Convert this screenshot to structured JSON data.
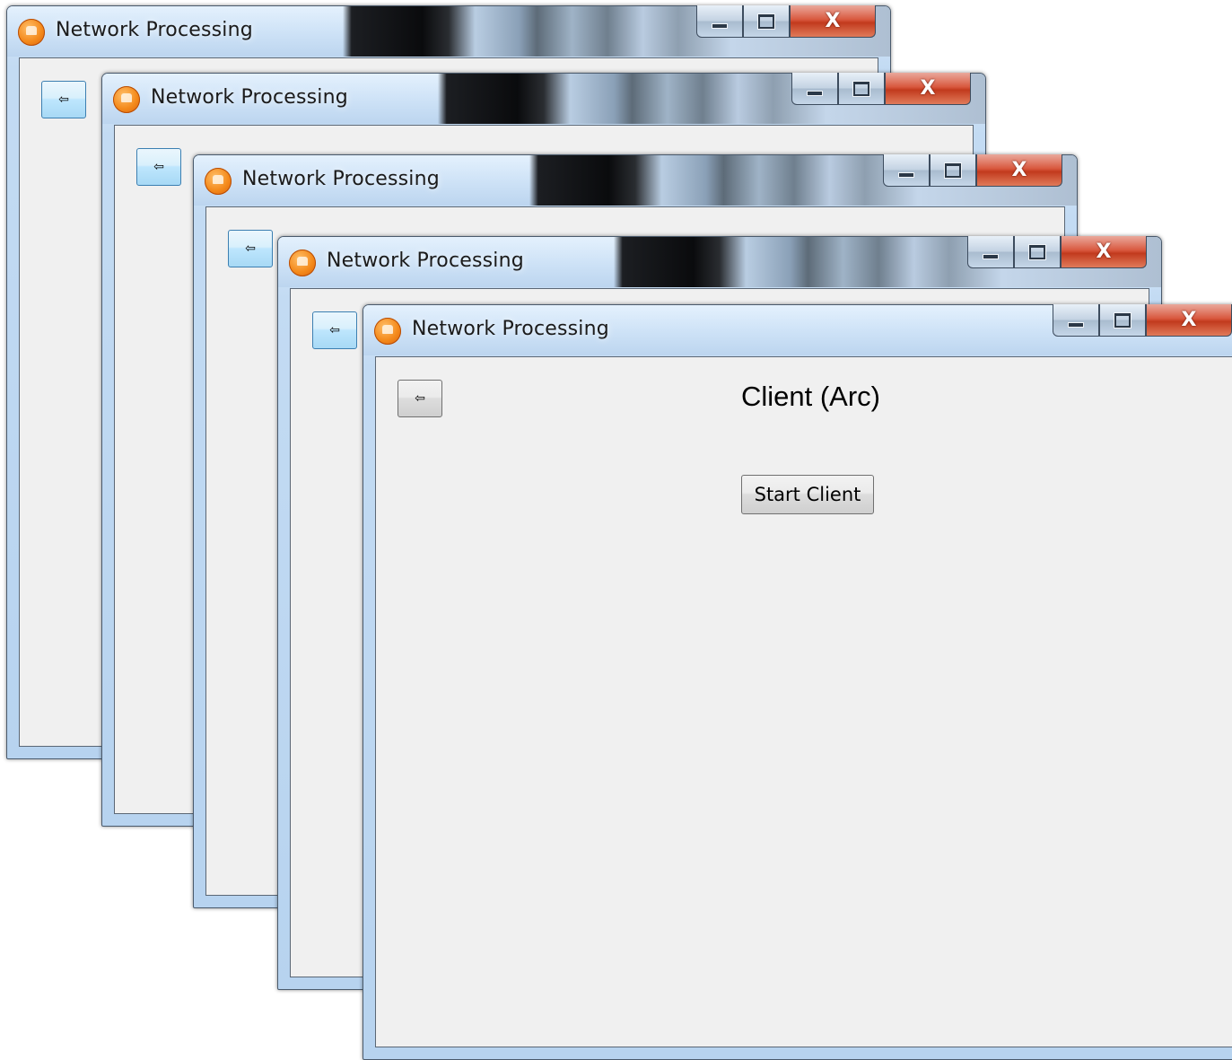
{
  "windows": [
    {
      "title": "Network Processing"
    },
    {
      "title": "Network Processing"
    },
    {
      "title": "Network Processing"
    },
    {
      "title": "Network Processing"
    },
    {
      "title": "Network Processing"
    }
  ],
  "caption_buttons": {
    "minimize": "",
    "maximize": "",
    "close": "X"
  },
  "back_button": {
    "icon": "back-arrow-icon",
    "glyph": "⇦"
  },
  "active_window": {
    "heading": "Client (Arc)",
    "start_button": "Start Client"
  },
  "colors": {
    "close_button": "#c9452a",
    "app_icon": "#f48a1b",
    "back_button_hover": "#bee6fd",
    "client_area": "#f0f0f0"
  }
}
